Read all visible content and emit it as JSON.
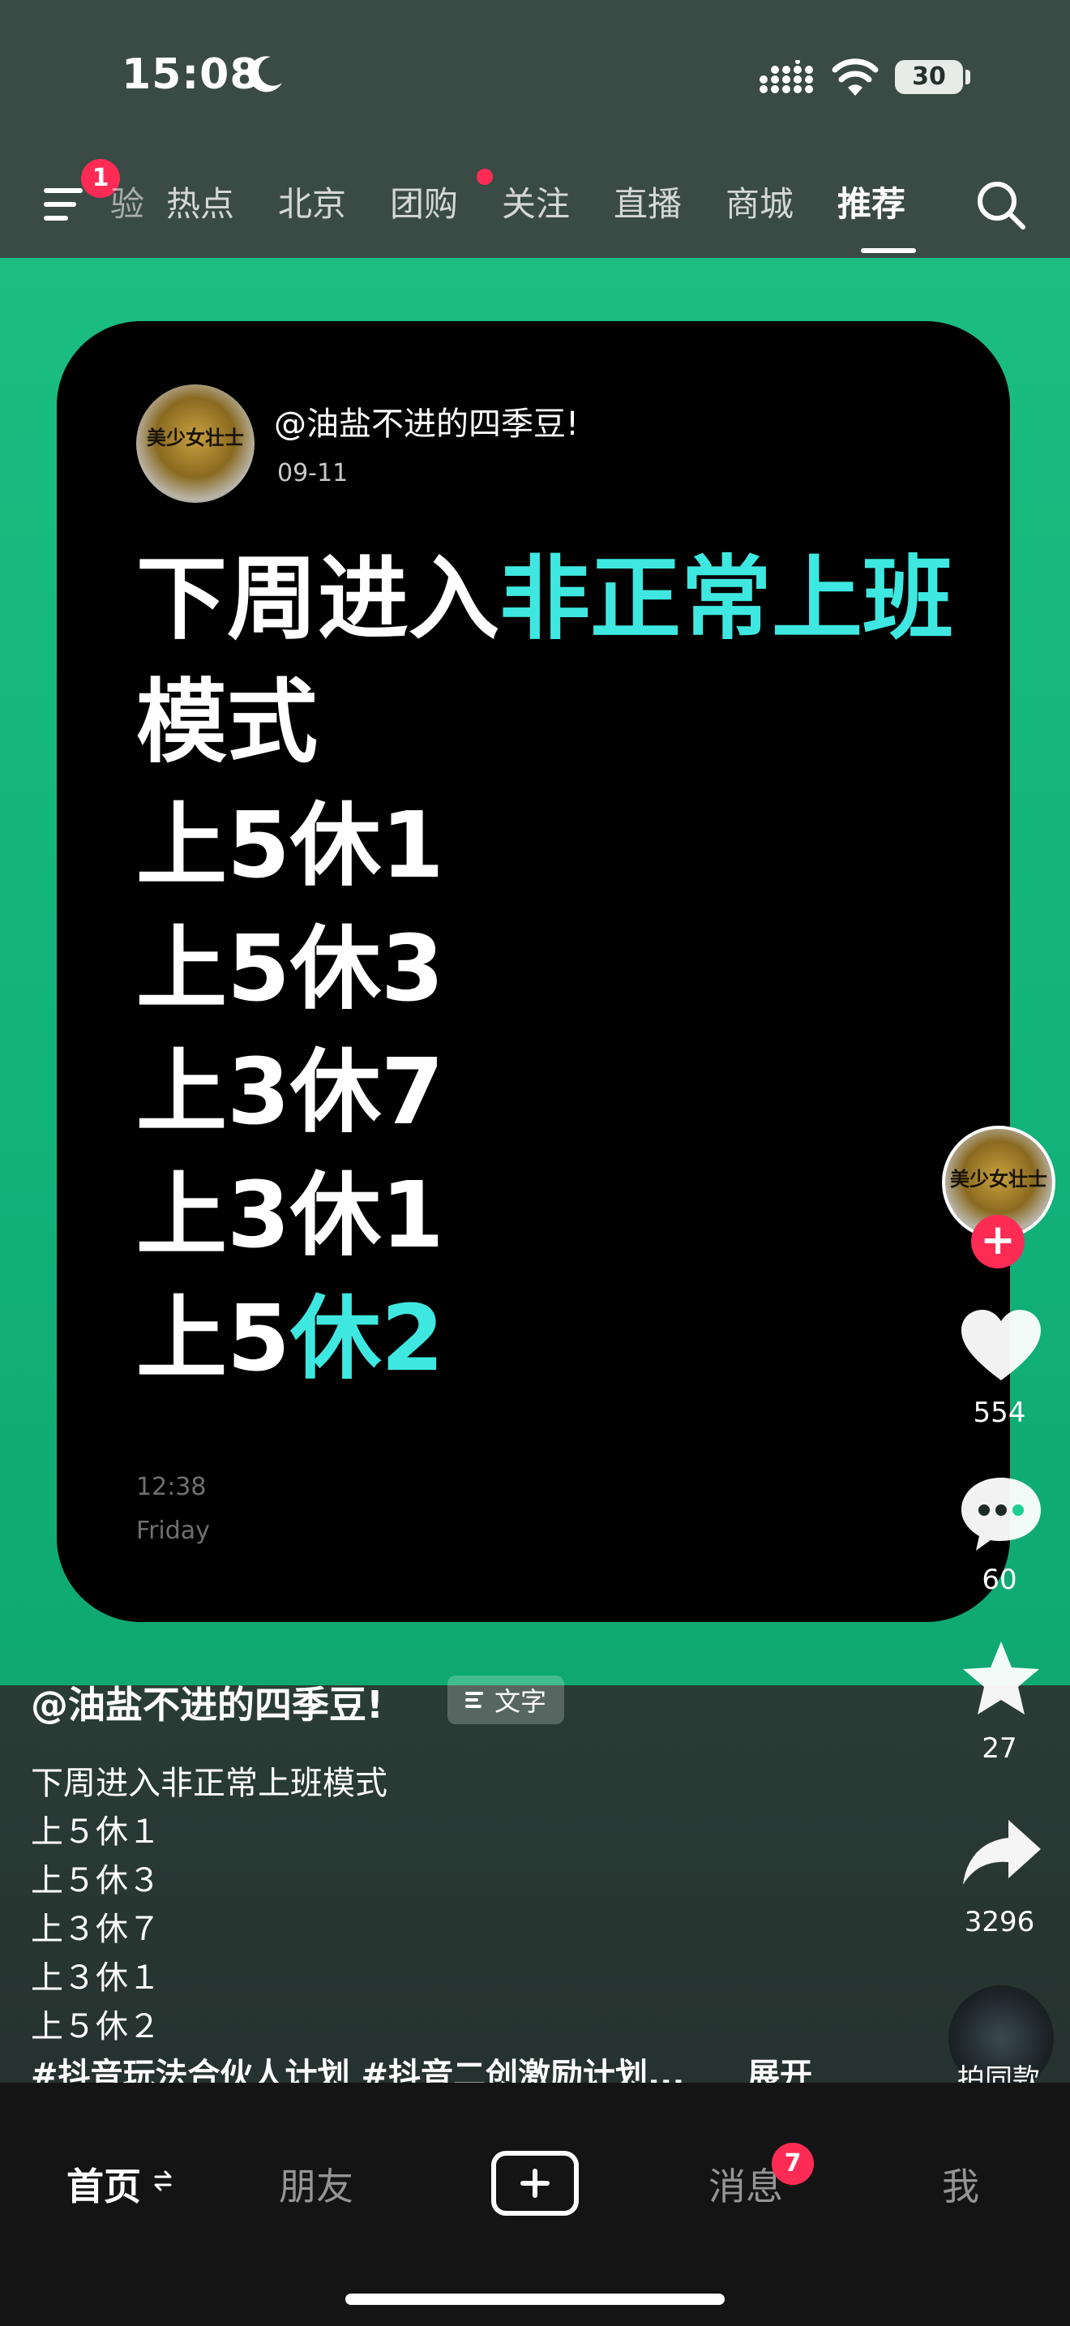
{
  "status_bar": {
    "time": "15:08",
    "battery": "30",
    "icons": [
      "moon-icon",
      "signal-icon",
      "wifi-icon",
      "battery-icon"
    ]
  },
  "top_nav": {
    "menu_badge": "1",
    "tabs": [
      "验",
      "热点",
      "北京",
      "团购",
      "关注",
      "直播",
      "商城",
      "推荐"
    ],
    "active_tab": "推荐",
    "accent_color": "#fe2c55"
  },
  "card": {
    "username": "@油盐不进的四季豆!",
    "date": "09-11",
    "avatar_text": "美少女壮士",
    "lines": [
      {
        "a": "下周进入",
        "b": "非正常上班"
      },
      {
        "a": "模式"
      },
      {
        "a": "上5休1"
      },
      {
        "a": "上5休3"
      },
      {
        "a": "上3休7"
      },
      {
        "a": "上3休1"
      },
      {
        "a": "上5",
        "b": "休2"
      }
    ],
    "time": "12:38",
    "day": "Friday",
    "highlight_color": "#3ee8e0"
  },
  "actions": {
    "likes": "554",
    "comments": "60",
    "favorites": "27",
    "shares": "3296",
    "remix_label": "拍同款",
    "follow_symbol": "+"
  },
  "description": {
    "username": "@油盐不进的四季豆!",
    "chip_label": "文字",
    "lines": [
      "下周进入非正常上班模式",
      "上５休１",
      "上５休３",
      "上３休７",
      "上３休１",
      "上５休２"
    ],
    "tags": "#抖音玩法合伙人计划 #抖音二创激励计划...",
    "expand": "展开"
  },
  "bottom_nav": {
    "home": "首页",
    "friends": "朋友",
    "messages": "消息",
    "messages_badge": "7",
    "me": "我"
  }
}
